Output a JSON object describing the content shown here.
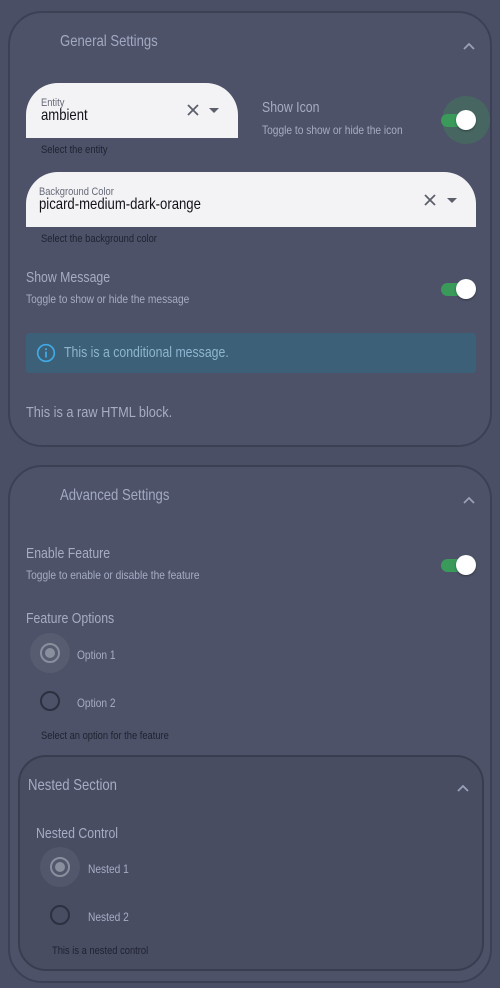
{
  "general": {
    "title": "General Settings",
    "entity": {
      "label": "Entity",
      "value": "ambient",
      "helper": "Select the entity"
    },
    "show_icon": {
      "title": "Show Icon",
      "description": "Toggle to show or hide the icon",
      "enabled": true
    },
    "background_color": {
      "label": "Background Color",
      "value": "picard-medium-dark-orange",
      "helper": "Select the background color"
    },
    "show_message": {
      "title": "Show Message",
      "description": "Toggle to show or hide the message",
      "enabled": true
    },
    "alert": {
      "text": "This is a conditional message.",
      "icon": "info-icon"
    },
    "raw_html": "This is a raw HTML block."
  },
  "advanced": {
    "title": "Advanced Settings",
    "enable_feature": {
      "title": "Enable Feature",
      "description": "Toggle to enable or disable the feature",
      "enabled": true
    },
    "feature_options": {
      "title": "Feature Options",
      "options": [
        {
          "label": "Option 1",
          "selected": true
        },
        {
          "label": "Option 2",
          "selected": false
        }
      ],
      "helper": "Select an option for the feature"
    },
    "nested": {
      "title": "Nested Section",
      "control": {
        "title": "Nested Control",
        "options": [
          {
            "label": "Nested 1",
            "selected": true
          },
          {
            "label": "Nested 2",
            "selected": false
          }
        ],
        "helper": "This is a nested control"
      }
    }
  },
  "colors": {
    "background": "#4a4f66",
    "toggle_on": "#3a9a5a",
    "alert_bg": "#3c6078",
    "field_bg": "#f3f3f5"
  }
}
